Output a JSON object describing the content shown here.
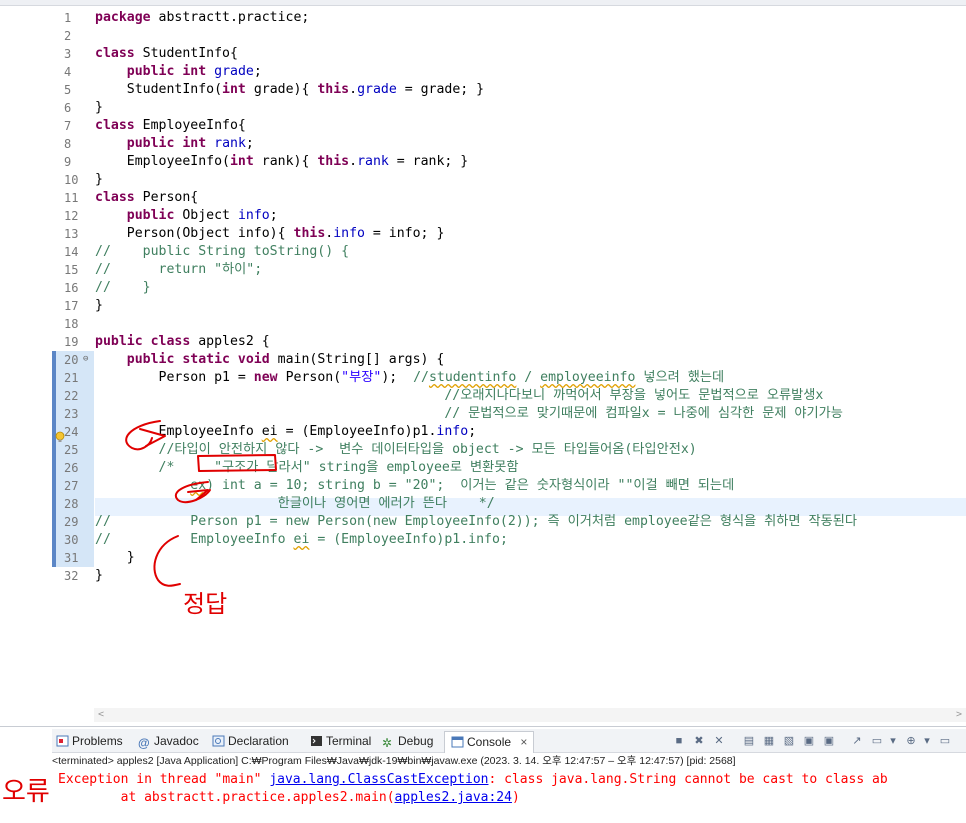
{
  "editor": {
    "lines": [
      {
        "n": "1",
        "html": "<span class='kw'>package</span> abstractt.practice;"
      },
      {
        "n": "2",
        "html": ""
      },
      {
        "n": "3",
        "html": "<span class='kw'>class</span> StudentInfo{"
      },
      {
        "n": "4",
        "html": "    <span class='kw'>public int</span> <span class='fld'>grade</span>;"
      },
      {
        "n": "5",
        "html": "    StudentInfo(<span class='kw'>int</span> grade){ <span class='kw'>this</span>.<span class='fld'>grade</span> = grade; }"
      },
      {
        "n": "6",
        "html": "}"
      },
      {
        "n": "7",
        "html": "<span class='kw'>class</span> EmployeeInfo{"
      },
      {
        "n": "8",
        "html": "    <span class='kw'>public int</span> <span class='fld'>rank</span>;"
      },
      {
        "n": "9",
        "html": "    EmployeeInfo(<span class='kw'>int</span> rank){ <span class='kw'>this</span>.<span class='fld'>rank</span> = rank; }"
      },
      {
        "n": "10",
        "html": "}"
      },
      {
        "n": "11",
        "html": "<span class='kw'>class</span> Person{"
      },
      {
        "n": "12",
        "html": "    <span class='kw'>public</span> Object <span class='fld'>info</span>;"
      },
      {
        "n": "13",
        "html": "    Person(Object info){ <span class='kw'>this</span>.<span class='fld'>info</span> = info; }"
      },
      {
        "n": "14",
        "html": "<span class='cmt'>//    public String toString() {</span>"
      },
      {
        "n": "15",
        "html": "<span class='cmt'>//      return \"하이\";</span>"
      },
      {
        "n": "16",
        "html": "<span class='cmt'>//    }</span>"
      },
      {
        "n": "17",
        "html": "}"
      },
      {
        "n": "18",
        "html": ""
      },
      {
        "n": "19",
        "html": "<span class='kw'>public class</span> apples2 {"
      },
      {
        "n": "20",
        "html": "    <span class='kw'>public static void</span> main(String[] args) {"
      },
      {
        "n": "21",
        "html": "        Person p1 = <span class='kw'>new</span> Person(<span class='str'>\"부장\"</span>);  <span class='cmt'>//<span class='squig'>studentinfo</span> / <span class='squig'>employeeinfo</span> 넣으려 했는데</span>"
      },
      {
        "n": "22",
        "html": "<span class='cmt'>                                            //오래지나다보니 까먹어서 부장을 넣어도 문법적으로 오류발생x</span>"
      },
      {
        "n": "23",
        "html": "<span class='cmt'>                                            // 문법적으로 맞기때문에 컴파일x = 나중에 심각한 문제 야기가능</span>"
      },
      {
        "n": "24",
        "html": "        EmployeeInfo <span class='squig'>ei</span> = (EmployeeInfo)p1.<span class='fld'>info</span>;"
      },
      {
        "n": "25",
        "html": "<span class='cmt'>        //타입이 안전하지 않다 ->  변수 데이터타입을 object -> 모든 타입들어옴(타입안전x)</span>"
      },
      {
        "n": "26",
        "html": "<span class='cmt'>        /*     \"구조가 달라서\" string을 employee로 변환못함</span>"
      },
      {
        "n": "27",
        "html": "<span class='cmt'>            <span class='squig'>ex</span>) int a = 10; string b = \"20\";  이거는 같은 숫자형식이라 \"\"이걸 빼면 되는데</span>"
      },
      {
        "n": "28",
        "html": "<span class='cmt'>                       한글이나 영어면 에러가 뜬다    */</span>"
      },
      {
        "n": "29",
        "html": "<span class='cmt'>//          Person p1 = new Person(new EmployeeInfo(2)); 즉 이거처럼 employee같은 형식을 취하면 작동된다</span>"
      },
      {
        "n": "30",
        "html": "<span class='cmt'>//          EmployeeInfo <span class='squig'>ei</span> = (EmployeeInfo)p1.info;</span>"
      },
      {
        "n": "31",
        "html": "    }"
      },
      {
        "n": "32",
        "html": "}"
      }
    ]
  },
  "console": {
    "tabs": {
      "problems": "Problems",
      "javadoc": "Javadoc",
      "declaration": "Declaration",
      "terminal": "Terminal",
      "debug": "Debug",
      "console": "Console",
      "close": "×"
    },
    "status": "<terminated> apples2 [Java Application] C:₩Program Files₩Java₩jdk-19₩bin₩javaw.exe  (2023. 3. 14. 오후 12:47:57 – 오후 12:47:57) [pid: 2568]",
    "error_prefix": "Exception in thread \"main\" ",
    "error_link": "java.lang.ClassCastException",
    "error_suffix": ": class java.lang.String cannot be cast to class ab",
    "trace_prefix": "        at abstractt.practice.apples2.main(",
    "trace_link": "apples2.java:24",
    "trace_suffix": ")"
  },
  "annotations": {
    "answer_label": "정답",
    "error_label": "오류"
  },
  "colors": {
    "keyword": "#7f0055",
    "field": "#0000c0",
    "string": "#2a00ff",
    "comment": "#3f7f5f",
    "error": "#ff0000",
    "link": "#0000ee",
    "ink": "#e00000"
  }
}
